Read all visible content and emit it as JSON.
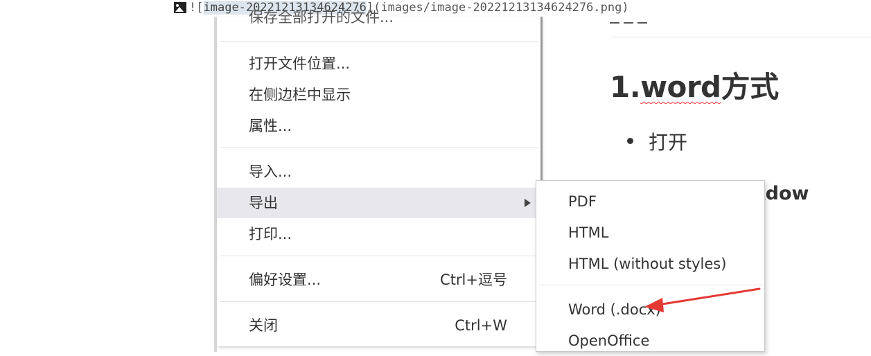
{
  "markdown_image": {
    "prefix": "!",
    "open_bracket": "[",
    "alt": "image-20221213134624276",
    "rest": "](images/image-20221213134624276.png)"
  },
  "main_menu": {
    "partial_top_label": "保存全部打开的文件...",
    "items": [
      {
        "label": "打开文件位置..."
      },
      {
        "label": "在侧边栏中显示"
      },
      {
        "label": "属性..."
      },
      {
        "label": "导入..."
      },
      {
        "label": "导出",
        "highlighted": true,
        "has_submenu": true
      },
      {
        "label": "打印..."
      },
      {
        "label": "偏好设置...",
        "shortcut": "Ctrl+逗号"
      },
      {
        "label": "关闭",
        "shortcut": "Ctrl+W"
      }
    ]
  },
  "export_submenu": {
    "items": [
      {
        "label": "PDF"
      },
      {
        "label": "HTML"
      },
      {
        "label": "HTML (without styles)"
      },
      {
        "label": "Word (.docx)"
      },
      {
        "label": "OpenOffice"
      }
    ]
  },
  "document": {
    "heading_prefix": "1.",
    "heading_word": "word",
    "heading_suffix": "方式",
    "bullet_text": "打开",
    "bold_fragment": "动markdow"
  },
  "colors": {
    "annotation_arrow": "#e53935",
    "menu_highlight": "#e8e8ec",
    "spellcheck_underline": "#e33333"
  }
}
